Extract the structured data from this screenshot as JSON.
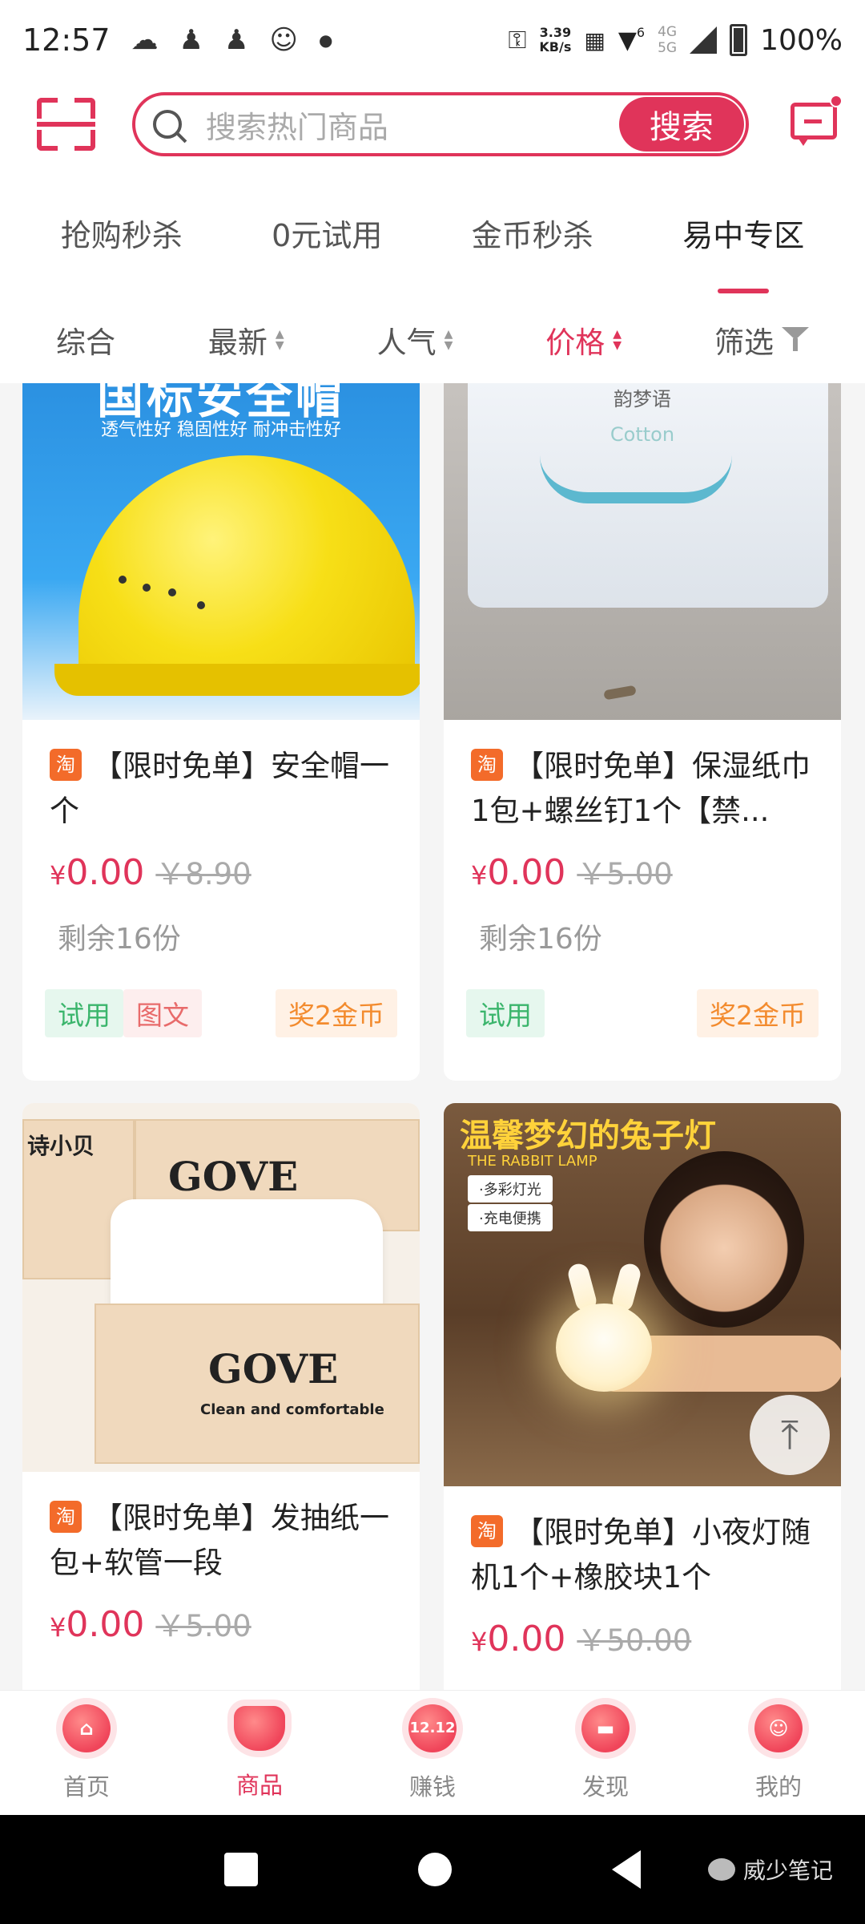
{
  "status_bar": {
    "time": "12:57",
    "net_speed_value": "3.39",
    "net_speed_unit": "KB/s",
    "net_gen_top": "4G",
    "net_gen_bottom": "5G",
    "signal_label": "6",
    "battery": "100%"
  },
  "header": {
    "search_placeholder": "搜索热门商品",
    "search_button": "搜索"
  },
  "category_tabs": [
    {
      "label": "抢购秒杀"
    },
    {
      "label": "0元试用"
    },
    {
      "label": "金币秒杀"
    },
    {
      "label": "易中专区"
    }
  ],
  "sort_bar": {
    "items": [
      {
        "label": "综合"
      },
      {
        "label": "最新"
      },
      {
        "label": "人气"
      },
      {
        "label": "价格"
      },
      {
        "label": "筛选"
      }
    ],
    "arrows": "◇"
  },
  "products": [
    {
      "badge": "淘",
      "title": "【限时免单】安全帽一个",
      "currency": "¥",
      "price": "0.00",
      "orig_price": "￥8.90",
      "remain": "剩余16份",
      "tag_try": "试用",
      "tag_pic": "图文",
      "reward": "奖2金币",
      "img_text_main": "国标安全帽",
      "img_text_sub": "透气性好  稳固性好  耐冲击性好"
    },
    {
      "badge": "淘",
      "title": "【限时免单】保湿纸巾1包+螺丝钉1个【禁...",
      "currency": "¥",
      "price": "0.00",
      "orig_price": "￥5.00",
      "remain": "剩余16份",
      "tag_try": "试用",
      "reward": "奖2金币",
      "img_text_main": "韵梦语",
      "img_text_sub": "Cotton"
    },
    {
      "badge": "淘",
      "title": "【限时免单】发抽纸一包+软管一段",
      "currency": "¥",
      "price": "0.00",
      "orig_price": "￥5.00",
      "img_text_main": "GOVE",
      "img_text_sub": "Clean and comfortable",
      "img_text_side": "诗小贝"
    },
    {
      "badge": "淘",
      "title": "【限时免单】小夜灯随机1个+橡胶块1个",
      "currency": "¥",
      "price": "0.00",
      "orig_price": "￥50.00",
      "img_text_main": "温馨梦幻的兔子灯",
      "img_text_sub": "THE RABBIT LAMP",
      "img_pill_1": "·多彩灯光",
      "img_pill_2": "·充电便携"
    }
  ],
  "bottom_nav": [
    {
      "label": "首页"
    },
    {
      "label": "商品"
    },
    {
      "label": "赚钱",
      "icon_text": "12.12"
    },
    {
      "label": "发现"
    },
    {
      "label": "我的"
    }
  ],
  "watermark": "威少笔记",
  "colors": {
    "accent": "#e0345a",
    "taobao_badge": "#f36b2a",
    "try_tag": "#3bb56c",
    "reward_tag": "#f38b2e"
  }
}
